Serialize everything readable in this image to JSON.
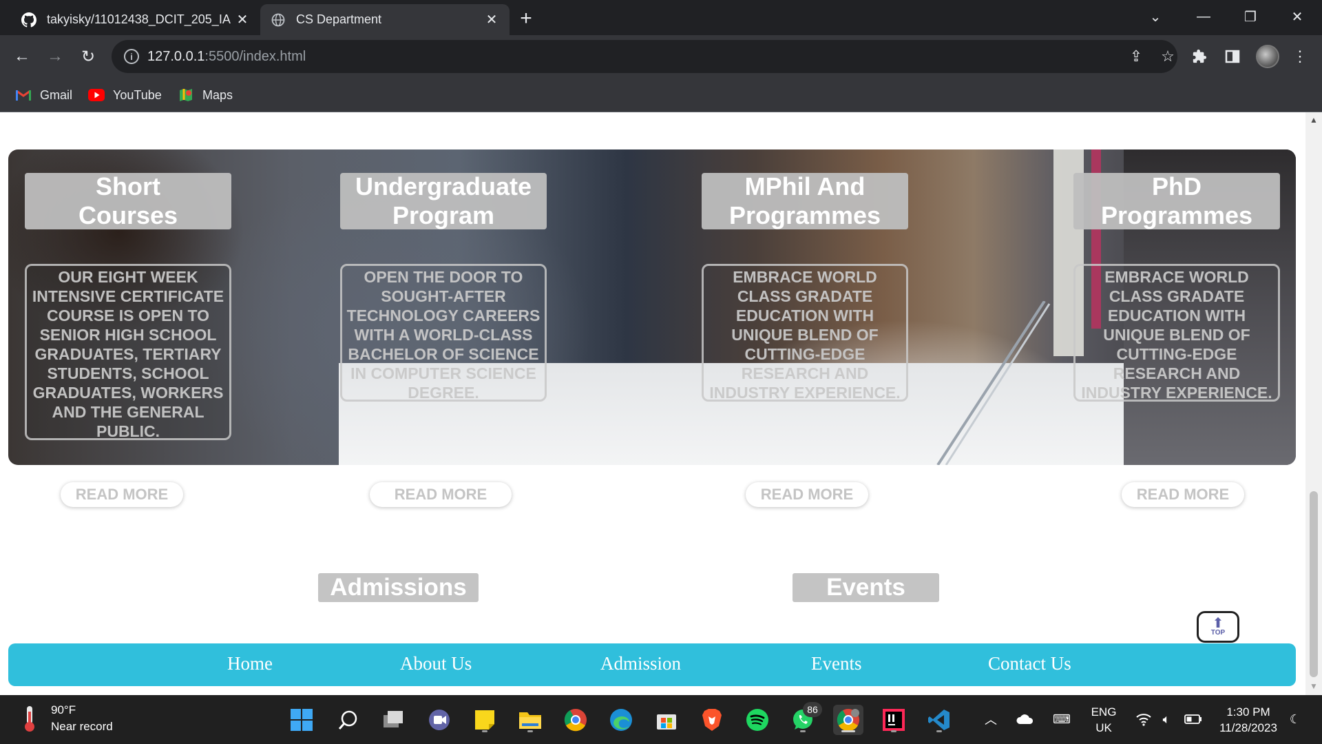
{
  "browser": {
    "tabs": [
      {
        "title": "takyisky/11012438_DCIT_205_IA",
        "icon": "github-icon",
        "active": false
      },
      {
        "title": "CS Department",
        "icon": "globe-icon",
        "active": true
      }
    ],
    "url_host": "127.0.0.1",
    "url_path": ":5500/index.html",
    "bookmarks": [
      {
        "label": "Gmail",
        "icon": "gmail-icon"
      },
      {
        "label": "YouTube",
        "icon": "youtube-icon"
      },
      {
        "label": "Maps",
        "icon": "maps-icon"
      }
    ]
  },
  "programs": [
    {
      "title_line1": "Short",
      "title_line2": "Courses",
      "description": "Our eight week intensive certificate course is open to senior high school graduates, tertiary students, school graduates, workers and the general public.",
      "read_more": "READ MORE"
    },
    {
      "title_line1": "Undergraduate",
      "title_line2": "Program",
      "description": "Open the door to sought-after technology careers with a world-class Bachelor of Science in Computer Science degree.",
      "read_more": "READ MORE"
    },
    {
      "title_line1": "MPhil And",
      "title_line2": "Programmes",
      "description": "Embrace world class gradate education with unique blend of cutting-edge research and industry experience.",
      "read_more": "READ MORE"
    },
    {
      "title_line1": "PhD",
      "title_line2": "Programmes",
      "description": "Embrace world class gradate education with unique blend of cutting-edge research and industry experience.",
      "read_more": "READ MORE"
    }
  ],
  "sections": {
    "admissions": "Admissions",
    "events": "Events"
  },
  "top_button": {
    "label": "TOP"
  },
  "footer_nav": [
    "Home",
    "About Us",
    "Admission",
    "Events",
    "Contact Us"
  ],
  "taskbar": {
    "weather_temp": "90°F",
    "weather_desc": "Near record",
    "whatsapp_badge": "86",
    "lang_line1": "ENG",
    "lang_line2": "UK",
    "time": "1:30 PM",
    "date": "11/28/2023"
  },
  "colors": {
    "footer_bg": "#30bfdc",
    "card_title_bg": "#bebebe",
    "tab_bar": "#202124"
  }
}
